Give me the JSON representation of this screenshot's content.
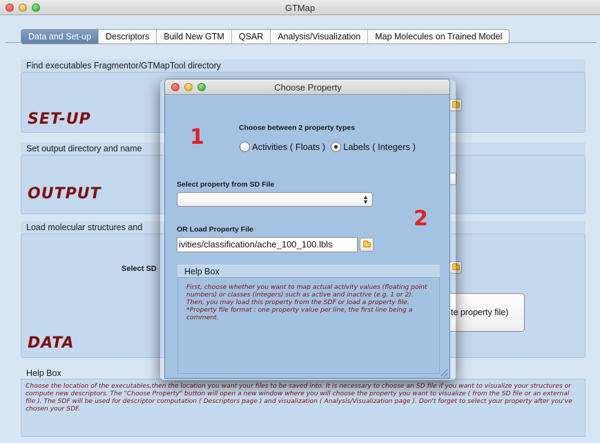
{
  "window": {
    "title": "GTMap"
  },
  "tabs": [
    {
      "label": "Data and Set-up",
      "active": true
    },
    {
      "label": "Descriptors",
      "active": false
    },
    {
      "label": "Build New GTM",
      "active": false
    },
    {
      "label": "QSAR",
      "active": false
    },
    {
      "label": "Analysis/Visualization",
      "active": false
    },
    {
      "label": "Map Molecules on Trained Model",
      "active": false
    }
  ],
  "sections": {
    "executables": {
      "heading": "Find executables Fragmentor/GTMapTool directory",
      "big_label": "SET-UP"
    },
    "output": {
      "heading": "Set output directory and name",
      "big_label": "OUTPUT"
    },
    "data": {
      "heading": "Load molecular structures and",
      "big_label": "DATA",
      "select_sd_label": "Select SD",
      "property_button_label": "te property file)"
    }
  },
  "help": {
    "heading": "Help Box",
    "text": "Choose the location of the executables,then the location you want your files to be saved into. It is necessary to choose an SD file if you want to visualize your structures or compute new descriptors. The \"Choose Property\" button will open a new window where you will choose the property you want to visualize ( from the SD file or an external file ). The SDF will be used for descriptor computation ( Descriptors page ) and visualization ( Analysis/Visualization page ). Don't forget to select your property after you've chosen your SDF."
  },
  "dialog": {
    "title": "Choose Property",
    "step1": "1",
    "step2": "2",
    "choose_label": "Choose between 2 property types",
    "radio_activities": "Activities ( Floats )",
    "radio_labels": "Labels ( Integers )",
    "selected_radio": "labels",
    "select_sd_label": "Select property from SD File",
    "sd_property_value": "",
    "load_file_label": "OR Load Property File",
    "property_file_path": "ivities/classification/ache_100_100.lbls",
    "help_heading": "Help Box",
    "help_text": "First, choose whether you want to map actual activity values (floating point numbers) or classes (integers) such as active and inactive (e.g. 1 or 2). Then, you may load this property from the SDF or load a property file.\n*Property file format : one property value per line, the first line being a comment."
  },
  "colors": {
    "accent_tab": "#6a8db5",
    "big_label": "#7d0f12",
    "step_number": "#e0201f",
    "help_text": "#7d0f12"
  }
}
